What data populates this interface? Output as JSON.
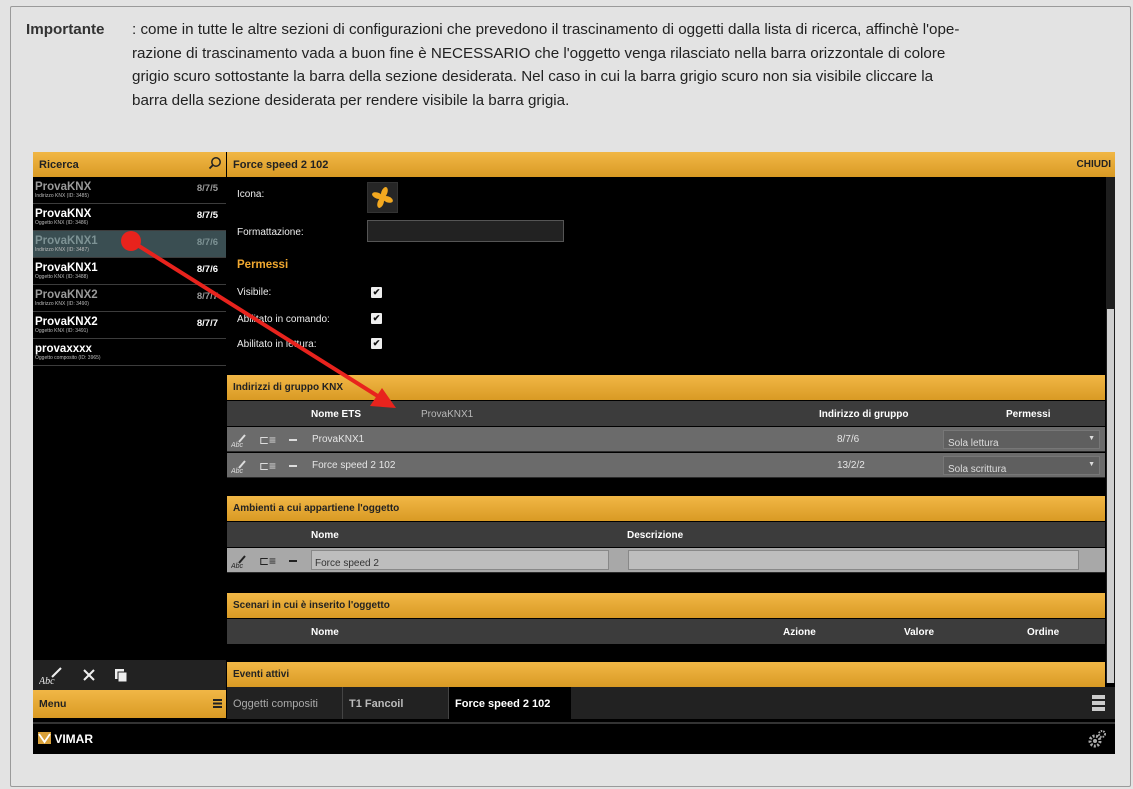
{
  "note": {
    "label": "Importante",
    "text1": ": come in tutte le altre sezioni di configurazioni che prevedono il trascinamento di oggetti dalla lista di ricerca, affinchè l'ope-",
    "text2": "razione di trascinamento vada a buon fine è NECESSARIO che l'oggetto venga rilasciato nella barra orizzontale di colore",
    "text3": "grigio scuro sottostante la barra della sezione desiderata. Nel caso in cui la barra grigio scuro non sia visibile cliccare la",
    "text4": "barra della sezione desiderata per rendere visibile la barra grigia."
  },
  "search": {
    "title": "Ricerca",
    "icon": "search-icon"
  },
  "results": [
    {
      "name": "ProvaKNX",
      "sub": "Indirizzo KNX (ID: 3485)",
      "code": "8/7/5",
      "state": "dim"
    },
    {
      "name": "ProvaKNX",
      "sub": "Oggetto KNX (ID: 3486)",
      "code": "8/7/5",
      "state": "normal"
    },
    {
      "name": "ProvaKNX1",
      "sub": "Indirizzo KNX (ID: 3487)",
      "code": "8/7/6",
      "state": "selected"
    },
    {
      "name": "ProvaKNX1",
      "sub": "Oggetto KNX (ID: 3488)",
      "code": "8/7/6",
      "state": "normal"
    },
    {
      "name": "ProvaKNX2",
      "sub": "Indirizzo KNX (ID: 3490)",
      "code": "8/7/7",
      "state": "dim"
    },
    {
      "name": "ProvaKNX2",
      "sub": "Oggetto KNX (ID: 3491)",
      "code": "8/7/7",
      "state": "normal"
    },
    {
      "name": "provaxxxx",
      "sub": "Oggetto composito (ID: 3965)",
      "code": "",
      "state": "normal"
    }
  ],
  "menu": {
    "label": "Menu"
  },
  "panel": {
    "title": "Force speed 2 102",
    "close": "CHIUDI"
  },
  "form": {
    "icon_label": "Icona:",
    "format_label": "Formattazione:",
    "perm_title": "Permessi",
    "visible_label": "Visibile:",
    "cmd_label": "Abilitato in comando:",
    "read_label": "Abilitato in lettura:"
  },
  "knx": {
    "title": "Indirizzi di gruppo KNX",
    "col_name": "Nome ETS",
    "col_addr": "Indirizzo di gruppo",
    "col_perm": "Permessi",
    "drag_ghost": "ProvaKNX1",
    "rows": [
      {
        "name": "ProvaKNX1",
        "addr": "8/7/6",
        "perm": "Sola lettura"
      },
      {
        "name": "Force speed 2 102",
        "addr": "13/2/2",
        "perm": "Sola scrittura"
      }
    ]
  },
  "env": {
    "title": "Ambienti a cui appartiene l'oggetto",
    "col_name": "Nome",
    "col_desc": "Descrizione",
    "row_name": "Force speed 2",
    "row_desc": ""
  },
  "scen": {
    "title": "Scenari in cui è inserito l'oggetto",
    "col_name": "Nome",
    "col_action": "Azione",
    "col_value": "Valore",
    "col_order": "Ordine"
  },
  "events": {
    "title": "Eventi attivi"
  },
  "tabs": [
    "Oggetti compositi",
    "T1 Fancoil",
    "Force speed 2 102"
  ],
  "footer": {
    "brand": "VIMAR"
  },
  "colors": {
    "accent": "#e8a935",
    "arrow": "#e8231d"
  }
}
